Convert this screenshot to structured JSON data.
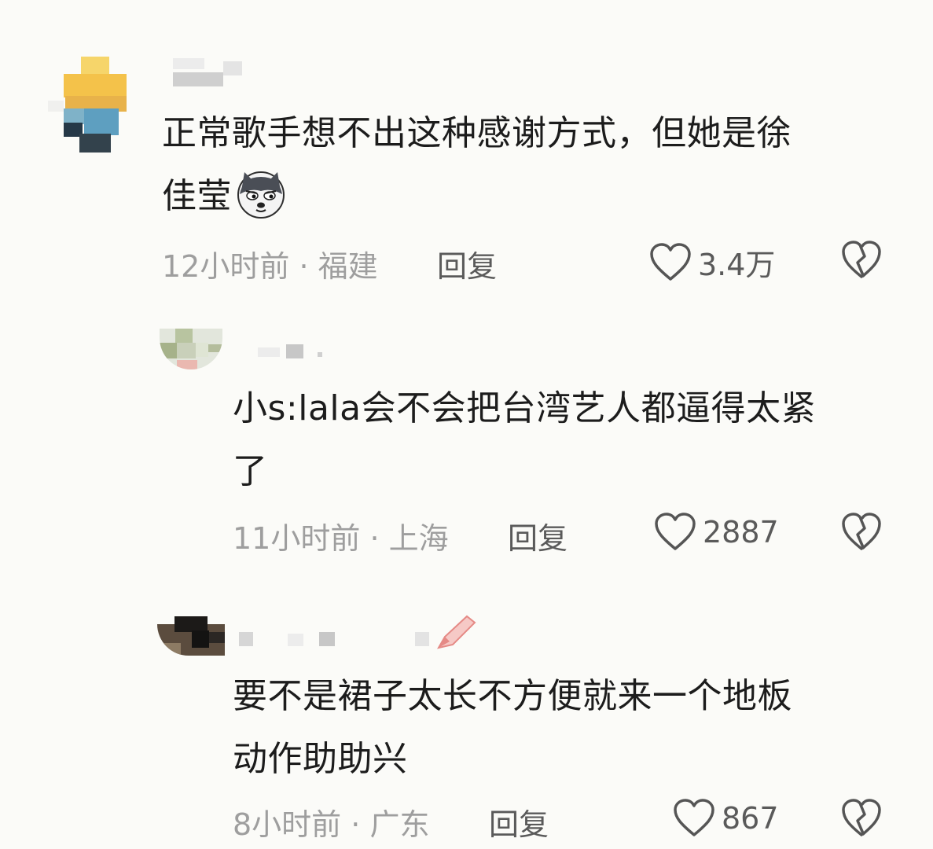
{
  "comments": [
    {
      "text_line1": "正常歌手想不出这种感谢方式，但她是徐",
      "text_line2": "佳莹",
      "emoji": "husky-sly-emoji",
      "time": "12小时前",
      "location": "福建",
      "meta_sep": " · ",
      "reply": "回复",
      "likes": "3.4万"
    },
    {
      "text_line1": "小s:lala会不会把台湾艺人都逼得太紧",
      "text_line2": "了",
      "time": "11小时前",
      "location": "上海",
      "meta_sep": " · ",
      "reply": "回复",
      "likes": "2887"
    },
    {
      "text_line1": "要不是裙子太长不方便就来一个地板",
      "text_line2": "动作助助兴",
      "time": "8小时前",
      "location": "广东",
      "meta_sep": " · ",
      "reply": "回复",
      "likes": "867"
    }
  ],
  "icons": {
    "like": "heart-outline-icon",
    "dislike": "broken-heart-icon"
  },
  "colors": {
    "background": "#fbfbf8",
    "text": "#1c1c1c",
    "meta": "#9e9e9e",
    "action": "#5a5a5a"
  }
}
